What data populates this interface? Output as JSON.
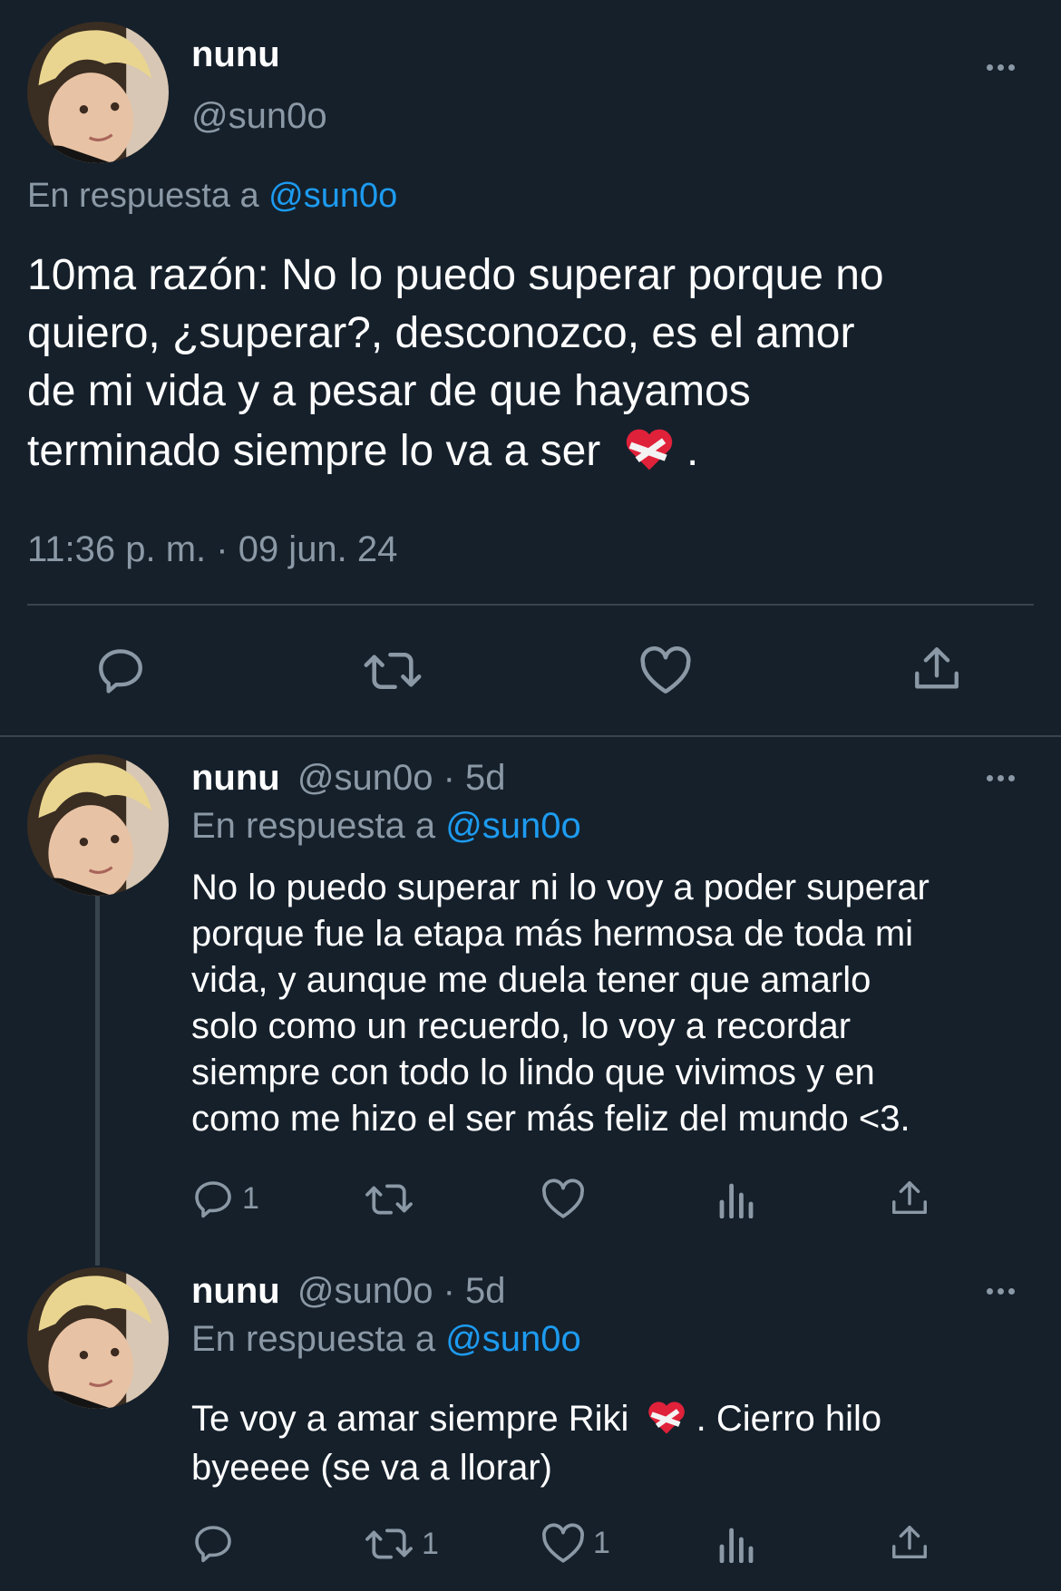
{
  "main_tweet": {
    "display_name": "nunu",
    "handle": "@sun0o",
    "reply_prefix": "En respuesta a",
    "reply_to": "@sun0o",
    "text_lines": [
      "10ma razón: No lo puedo superar porque no",
      "quiero, ¿superar?, desconozco, es el amor",
      "de mi vida y a pesar de que hayamos",
      "terminado siempre lo va a ser"
    ],
    "text_end": ".",
    "emoji": "mending-heart",
    "timestamp": "11:36 p. m. · 09 jun. 24"
  },
  "reply1": {
    "display_name": "nunu",
    "handle": "@sun0o",
    "time": "· 5d",
    "reply_prefix": "En respuesta a",
    "reply_to": "@sun0o",
    "text_lines": [
      "No lo puedo superar ni lo voy a poder superar",
      "porque fue la etapa más hermosa de toda mi",
      "vida, y aunque me duela tener que amarlo",
      "solo como un recuerdo, lo voy a recordar",
      "siempre con todo lo lindo que vivimos y en",
      "como me hizo el ser más feliz del mundo <3."
    ],
    "reply_count": "1"
  },
  "reply2": {
    "display_name": "nunu",
    "handle": "@sun0o",
    "time": "· 5d",
    "reply_prefix": "En respuesta a",
    "reply_to": "@sun0o",
    "text_line1_before": "Te voy a amar siempre Riki",
    "text_line1_after": ". Cierro hilo",
    "text_line2": "byeeee (se va a llorar)",
    "retweet_count": "1",
    "like_count": "1"
  },
  "colors": {
    "background": "#15202b",
    "text": "#ffffff",
    "muted": "#8b98a5",
    "link": "#1d9bf0",
    "divider": "#38444d"
  }
}
